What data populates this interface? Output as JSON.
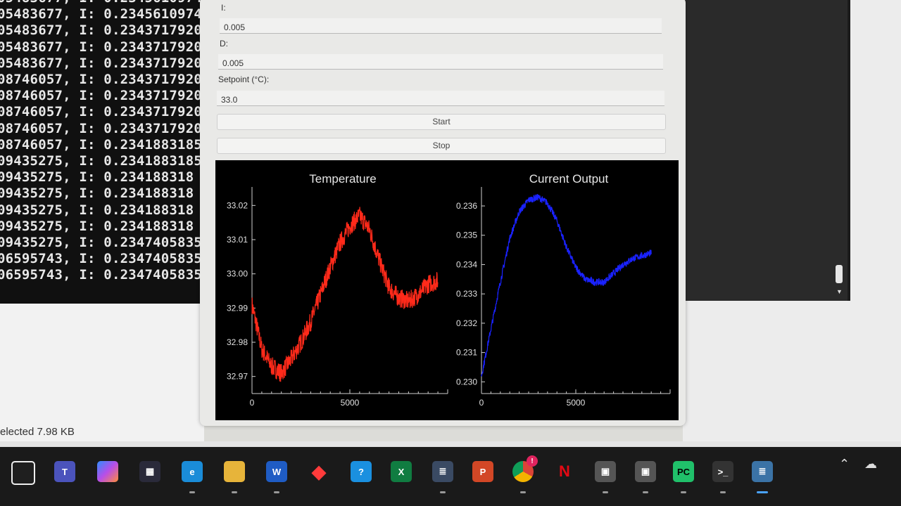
{
  "terminal": {
    "lines": [
      "05483677, I: 0.2345610974",
      "05483677, I: 0.2345610974",
      "05483677, I: 0.2343717920",
      "05483677, I: 0.2343717920",
      "05483677, I: 0.2343717920",
      "08746057, I: 0.2343717920",
      "08746057, I: 0.2343717920",
      "08746057, I: 0.2343717920",
      "08746057, I: 0.2343717920",
      "08746057, I: 0.2341883185",
      "09435275, I: 0.2341883185",
      "09435275, I: 0.234188318",
      "09435275, I: 0.234188318",
      "09435275, I: 0.234188318",
      "09435275, I: 0.234188318",
      "09435275, I: 0.2347405835",
      "06595743, I: 0.2347405835",
      "06595743, I: 0.2347405835"
    ]
  },
  "explorer": {
    "status": "elected  7.98 KB"
  },
  "controls": {
    "i_label": "I:",
    "i_value": "0.005",
    "d_label": "D:",
    "d_value": "0.005",
    "setpoint_label": "Setpoint (°C):",
    "setpoint_value": "33.0",
    "start_label": "Start",
    "stop_label": "Stop"
  },
  "colors": {
    "temperature_line": "#ff2a1a",
    "current_line": "#1a22ff",
    "plot_bg": "#000000"
  },
  "chart_data": [
    {
      "type": "line",
      "title": "Temperature",
      "xlabel": "",
      "ylabel": "",
      "xticks": [
        0,
        5000
      ],
      "yticks": [
        32.97,
        32.98,
        32.99,
        33.0,
        33.01,
        33.02
      ],
      "ytick_labels": [
        "32.97",
        "32.98",
        "32.99",
        "33.00",
        "33.01",
        "33.02"
      ],
      "xlim": [
        0,
        10000
      ],
      "ylim": [
        32.965,
        33.025
      ],
      "series": [
        {
          "x": [
            0,
            500,
            1000,
            1500,
            2000,
            2500,
            3000,
            3500,
            4000,
            4500,
            5000,
            5500,
            6000,
            6500,
            7000,
            7500,
            8000,
            8500,
            9000,
            9500
          ],
          "values": [
            32.991,
            32.978,
            32.973,
            32.971,
            32.975,
            32.98,
            32.986,
            32.994,
            33.002,
            33.009,
            33.014,
            33.017,
            33.013,
            33.004,
            32.996,
            32.993,
            32.992,
            32.994,
            32.997,
            32.998
          ]
        }
      ]
    },
    {
      "type": "line",
      "title": "Current Output",
      "xlabel": "",
      "ylabel": "",
      "xticks": [
        0,
        5000
      ],
      "yticks": [
        0.23,
        0.231,
        0.232,
        0.233,
        0.234,
        0.235,
        0.236
      ],
      "ytick_labels": [
        "0.230",
        "0.231",
        "0.232",
        "0.233",
        "0.234",
        "0.235",
        "0.236"
      ],
      "xlim": [
        0,
        10000
      ],
      "ylim": [
        0.2296,
        0.2366
      ],
      "series": [
        {
          "x": [
            0,
            500,
            1000,
            1500,
            2000,
            2500,
            3000,
            3500,
            4000,
            4500,
            5000,
            5500,
            6000,
            6500,
            7000,
            7500,
            8000,
            8500,
            9000
          ],
          "values": [
            0.2302,
            0.2318,
            0.2334,
            0.2349,
            0.2358,
            0.2362,
            0.2363,
            0.2361,
            0.2355,
            0.2346,
            0.2339,
            0.2335,
            0.2334,
            0.2334,
            0.2337,
            0.234,
            0.2342,
            0.2343,
            0.2344
          ]
        }
      ]
    }
  ],
  "taskbar": {
    "icons": [
      "start-icon",
      "teams-icon",
      "copilot-icon",
      "store-icon",
      "edge-icon",
      "file-explorer-icon",
      "word-icon",
      "office-icon",
      "tips-icon",
      "excel-icon",
      "python-idle-icon",
      "powerpoint-icon",
      "chrome-icon",
      "netflix-icon",
      "app-icon-1",
      "app-icon-2",
      "pycharm-icon",
      "terminal-icon",
      "python-icon"
    ],
    "chrome_badge": "!",
    "word_letter": "W",
    "excel_letter": "X",
    "powerpoint_letter": "P",
    "netflix_letter": "N",
    "pycharm_letters": "PC"
  }
}
